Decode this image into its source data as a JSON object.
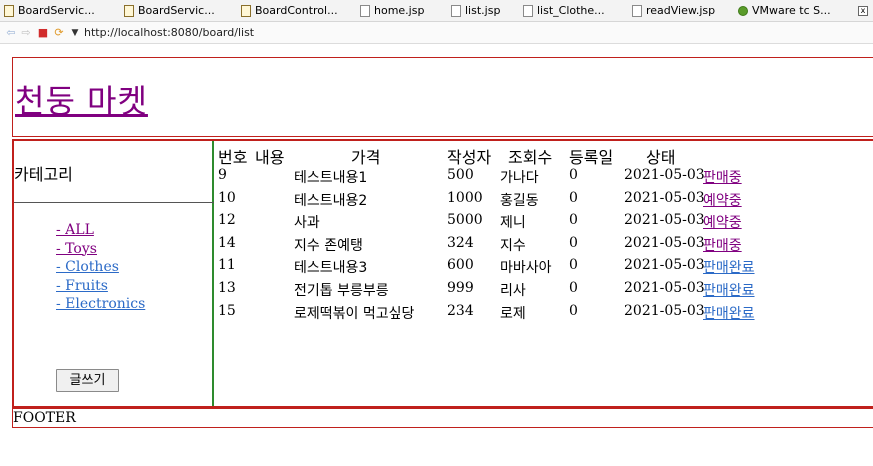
{
  "tabs": [
    {
      "label": "BoardServic...",
      "icon": "java-file-icon"
    },
    {
      "label": "BoardServic...",
      "icon": "java-file-icon"
    },
    {
      "label": "BoardControl...",
      "icon": "java-file-icon"
    },
    {
      "label": "home.jsp",
      "icon": "jsp-file-icon"
    },
    {
      "label": "list.jsp",
      "icon": "jsp-file-icon"
    },
    {
      "label": "list_Clothe...",
      "icon": "jsp-file-icon"
    },
    {
      "label": "readView.jsp",
      "icon": "jsp-file-icon"
    },
    {
      "label": "VMware tc S...",
      "icon": "vmware-icon"
    }
  ],
  "browser": {
    "url": "http://localhost:8080/board/list"
  },
  "header": {
    "title": "천둥 마켓"
  },
  "sidebar": {
    "title": "카테고리",
    "categories": [
      "- ALL",
      "- Toys",
      "- Clothes",
      "- Fruits",
      "- Electronics"
    ],
    "write_button": "글쓰기"
  },
  "table": {
    "headers": {
      "no": "번호",
      "content": "내용",
      "price": "가격",
      "writer": "작성자",
      "views": "조회수",
      "date": "등록일",
      "status": "상태"
    },
    "rows": [
      {
        "no": "9",
        "content": "테스트내용1",
        "price": "500",
        "writer": "가나다",
        "views": "0",
        "date": "2021-05-03",
        "status": "판매중"
      },
      {
        "no": "10",
        "content": "테스트내용2",
        "price": "1000",
        "writer": "홍길동",
        "views": "0",
        "date": "2021-05-03",
        "status": "예약중"
      },
      {
        "no": "12",
        "content": "사과",
        "price": "5000",
        "writer": "제니",
        "views": "0",
        "date": "2021-05-03",
        "status": "예약중"
      },
      {
        "no": "14",
        "content": "지수 존예탱",
        "price": "324",
        "writer": "지수",
        "views": "0",
        "date": "2021-05-03",
        "status": "판매중"
      },
      {
        "no": "11",
        "content": "테스트내용3",
        "price": "600",
        "writer": "마바사아",
        "views": "0",
        "date": "2021-05-03",
        "status": "판매완료"
      },
      {
        "no": "13",
        "content": "전기톱 부릉부릉",
        "price": "999",
        "writer": "리사",
        "views": "0",
        "date": "2021-05-03",
        "status": "판매완료"
      },
      {
        "no": "15",
        "content": "로제떡볶이 먹고싶당",
        "price": "234",
        "writer": "로제",
        "views": "0",
        "date": "2021-05-03",
        "status": "판매완료"
      }
    ]
  },
  "footer": {
    "text": "FOOTER"
  },
  "colors": {
    "border": "#c0201c",
    "aside_border": "#2e8b2e",
    "visited_link": "#800080",
    "link": "#2b6ac7"
  }
}
